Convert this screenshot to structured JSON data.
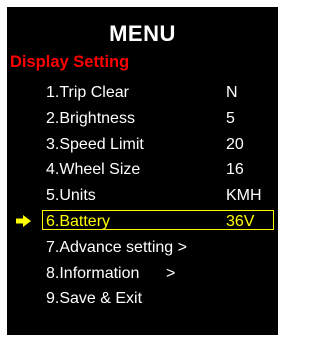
{
  "title": "MENU",
  "section": "Display Setting",
  "colors": {
    "background": "#000000",
    "text": "#ffffff",
    "section": "#ff0000",
    "selected": "#ffff00"
  },
  "selected_index": 5,
  "items": [
    {
      "label": "1.Trip Clear",
      "value": "N"
    },
    {
      "label": "2.Brightness",
      "value": "5"
    },
    {
      "label": "3.Speed Limit",
      "value": "20"
    },
    {
      "label": "4.Wheel Size",
      "value": "16"
    },
    {
      "label": "5.Units",
      "value": "KMH"
    },
    {
      "label": "6.Battery",
      "value": "36V"
    },
    {
      "label": "7.Advance setting >",
      "value": ""
    },
    {
      "label": "8.Information      >",
      "value": ""
    },
    {
      "label": "9.Save & Exit",
      "value": ""
    }
  ],
  "selector_icon": "right-arrow-icon"
}
